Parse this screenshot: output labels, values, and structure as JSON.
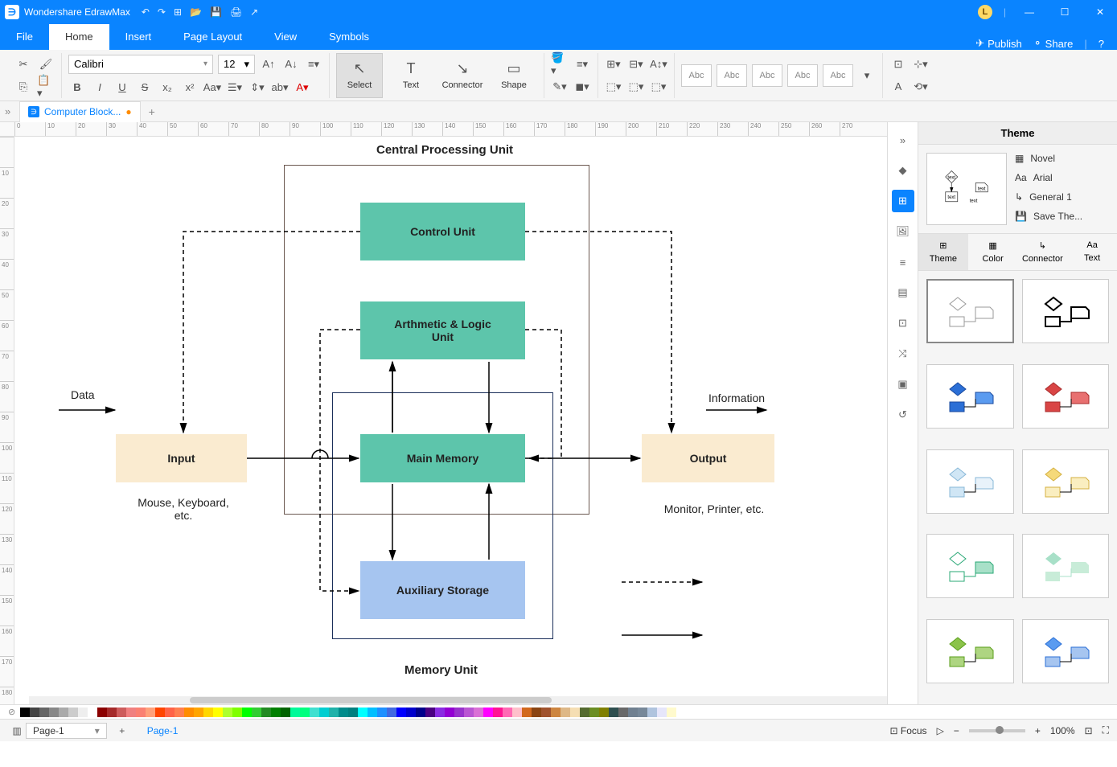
{
  "titlebar": {
    "app_name": "Wondershare EdrawMax",
    "avatar_letter": "L"
  },
  "menu": {
    "file": "File",
    "home": "Home",
    "insert": "Insert",
    "page_layout": "Page Layout",
    "view": "View",
    "symbols": "Symbols",
    "publish": "Publish",
    "share": "Share"
  },
  "ribbon": {
    "font": "Calibri",
    "size": "12",
    "select": "Select",
    "text": "Text",
    "connector": "Connector",
    "shape": "Shape",
    "abc": "Abc"
  },
  "doc_tab": "Computer Block...",
  "diagram": {
    "title_top": "Central Processing Unit",
    "title_bottom": "Memory Unit",
    "control_unit": "Control Unit",
    "alu": "Arthmetic & Logic\nUnit",
    "main_memory": "Main Memory",
    "aux_storage": "Auxiliary Storage",
    "input": "Input",
    "output": "Output",
    "data": "Data",
    "information": "Information",
    "input_sub": "Mouse, Keyboard,\netc.",
    "output_sub": "Monitor, Printer, etc."
  },
  "theme_panel": {
    "title": "Theme",
    "novel": "Novel",
    "arial": "Arial",
    "general": "General 1",
    "save": "Save The...",
    "tab_theme": "Theme",
    "tab_color": "Color",
    "tab_connector": "Connector",
    "tab_text": "Text",
    "preview_text": "text"
  },
  "statusbar": {
    "page_sel": "Page-1",
    "page_tab": "Page-1",
    "focus": "Focus",
    "zoom": "100%"
  },
  "palette_colors": [
    "#000",
    "#444",
    "#666",
    "#888",
    "#aaa",
    "#ccc",
    "#eee",
    "#fff",
    "#8b0000",
    "#a52a2a",
    "#cd5c5c",
    "#f08080",
    "#fa8072",
    "#ffa07a",
    "#ff4500",
    "#ff6347",
    "#ff7f50",
    "#ff8c00",
    "#ffa500",
    "#ffd700",
    "#ffff00",
    "#adff2f",
    "#7fff00",
    "#00ff00",
    "#32cd32",
    "#228b22",
    "#008000",
    "#006400",
    "#00fa9a",
    "#00ff7f",
    "#40e0d0",
    "#00ced1",
    "#20b2aa",
    "#008b8b",
    "#008080",
    "#00ffff",
    "#00bfff",
    "#1e90ff",
    "#4169e1",
    "#0000ff",
    "#0000cd",
    "#00008b",
    "#4b0082",
    "#8a2be2",
    "#9400d3",
    "#9932cc",
    "#ba55d3",
    "#da70d6",
    "#ff00ff",
    "#ff1493",
    "#ff69b4",
    "#ffc0cb",
    "#d2691e",
    "#8b4513",
    "#a0522d",
    "#cd853f",
    "#deb887",
    "#f5deb3",
    "#556b2f",
    "#6b8e23",
    "#808000",
    "#2f4f4f",
    "#696969",
    "#708090",
    "#778899",
    "#b0c4de",
    "#e6e6fa",
    "#fffacd"
  ]
}
